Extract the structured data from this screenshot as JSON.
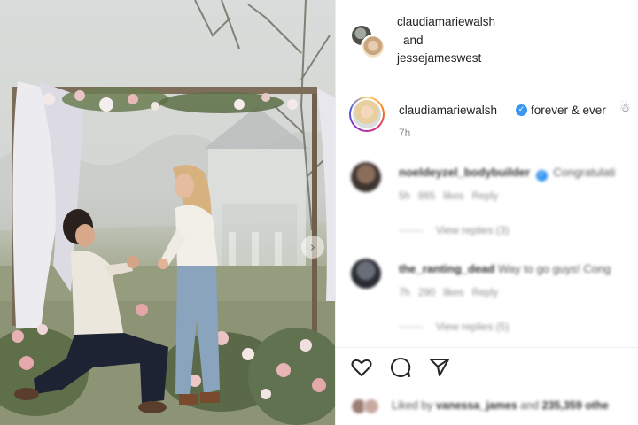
{
  "post": {
    "owners": {
      "primary": "claudiamariewalsh",
      "joiner": "and",
      "secondary": "jessejameswest"
    },
    "caption": {
      "username": "claudiamariewalsh",
      "text": "forever & ever",
      "time_ago": "7h",
      "verified_icon": "check-icon",
      "emoji_icon": "snowman-icon"
    },
    "comments": [
      {
        "username": "noeldeyzel_bodybuilder",
        "text": "Congratulati",
        "time_ago": "5h",
        "likes": "865 likes",
        "reply_label": "Reply",
        "view_replies": "View replies (3)"
      },
      {
        "username": "the_ranting_dead",
        "text": "Way to go guys! Cong",
        "time_ago": "7h",
        "likes": "290 likes",
        "reply_label": "Reply",
        "view_replies": "View replies (5)"
      }
    ],
    "actions": {
      "like_icon": "heart-icon",
      "comment_icon": "comment-icon",
      "share_icon": "paper-plane-icon"
    },
    "likes": {
      "prefix": "Liked by",
      "first_user": "vanessa_james",
      "middle": "and",
      "count": "235,359 othe"
    },
    "media": {
      "next_icon": "chevron-right-icon"
    }
  },
  "colors": {
    "verified": "#3897f0",
    "muted_text": "#8e8e8e",
    "divider": "#efefef"
  }
}
